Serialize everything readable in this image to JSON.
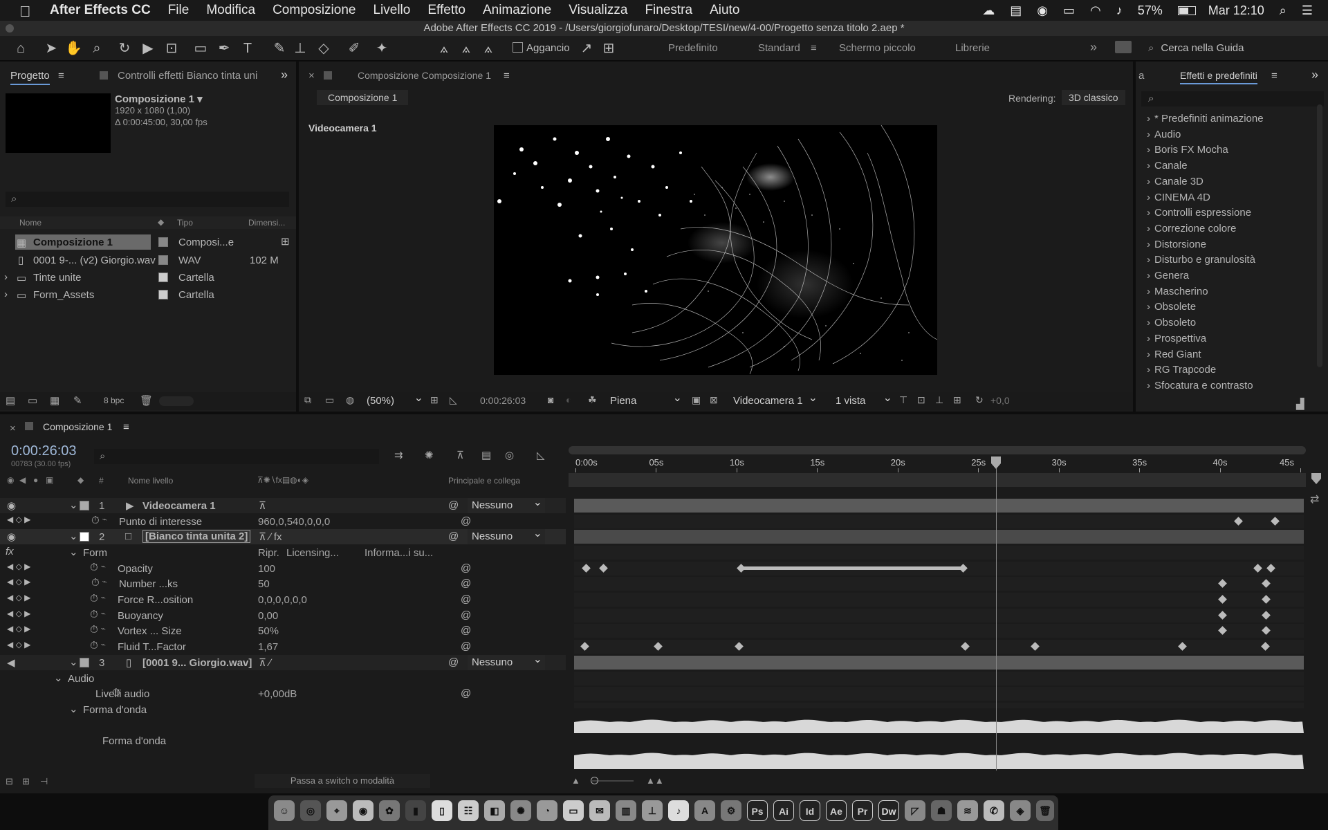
{
  "menubar": {
    "app_name": "After Effects CC",
    "items": [
      "File",
      "Modifica",
      "Composizione",
      "Livello",
      "Effetto",
      "Animazione",
      "Visualizza",
      "Finestra",
      "Aiuto"
    ],
    "battery": "57%",
    "clock": "Mar 12:10"
  },
  "window_title": "Adobe After Effects CC 2019 - /Users/giorgiofunaro/Desktop/TESI/new/4-00/Progetto senza titolo 2.aep *",
  "toolbar": {
    "snap_label": "Aggancio",
    "workspaces": [
      "Predefinito",
      "Standard",
      "Schermo piccolo",
      "Librerie"
    ],
    "search_placeholder": "Cerca nella Guida"
  },
  "project_panel": {
    "tab_label": "Progetto",
    "effect_controls_tab": "Controlli effetti Bianco tinta uni",
    "comp_name": "Composizione 1 ▾",
    "comp_res": "1920 x 1080 (1,00)",
    "comp_duration": "Δ 0:00:45:00, 30,00 fps",
    "col_name": "Nome",
    "col_type": "Tipo",
    "col_size": "Dimensi...",
    "bpc": "8 bpc",
    "items": [
      {
        "name": "Composizione 1",
        "type": "Composi...e",
        "size": ""
      },
      {
        "name": "0001 9-... (v2) Giorgio.wav",
        "type": "WAV",
        "size": "102 M"
      },
      {
        "name": "Tinte unite",
        "type": "Cartella",
        "size": ""
      },
      {
        "name": "Form_Assets",
        "type": "Cartella",
        "size": ""
      }
    ]
  },
  "comp_panel": {
    "tab_label": "Composizione Composizione 1",
    "breadcrumb": "Composizione 1",
    "rendering_label": "Rendering:",
    "renderer": "3D classico",
    "camera_label": "Videocamera 1",
    "zoom": "(50%)",
    "timecode": "0:00:26:03",
    "resolution": "Piena",
    "active_camera": "Videocamera 1",
    "views": "1 vista",
    "exposure": "+0,0"
  },
  "effects_panel": {
    "tab_label": "Effetti e predefiniti",
    "tab_left": "a",
    "items": [
      "* Predefiniti animazione",
      "Audio",
      "Boris FX Mocha",
      "Canale",
      "Canale 3D",
      "CINEMA 4D",
      "Controlli espressione",
      "Correzione colore",
      "Distorsione",
      "Disturbo e granulosità",
      "Genera",
      "Mascherino",
      "Obsolete",
      "Obsoleto",
      "Prospettiva",
      "Red Giant",
      "RG Trapcode",
      "Sfocatura e contrasto"
    ]
  },
  "timeline": {
    "tab_label": "Composizione 1",
    "timecode": "0:00:26:03",
    "frame_info": "00783 (30.00 fps)",
    "col_hash": "#",
    "col_layer_name": "Nome livello",
    "col_parent": "Principale e collega",
    "ruler": [
      "0:00s",
      "05s",
      "10s",
      "15s",
      "20s",
      "25s",
      "30s",
      "35s",
      "40s",
      "45s"
    ],
    "playhead_fraction": 0.58,
    "toggle_label": "Passa a switch o modalità",
    "rows": [
      {
        "num": "1",
        "name": "Videocamera 1",
        "value": "",
        "parent": "Nessuno"
      },
      {
        "num": "",
        "name": "Punto di interesse",
        "value": "960,0,540,0,0,0",
        "parent": ""
      },
      {
        "num": "2",
        "name": "[Bianco tinta unita 2]",
        "value": "",
        "parent": "Nessuno"
      },
      {
        "num": "",
        "name": "Form",
        "value": "Ripr.",
        "extra1": "Licensing...",
        "extra2": "Informa...i su...",
        "parent": ""
      },
      {
        "num": "",
        "name": "Opacity",
        "value": "100",
        "parent": ""
      },
      {
        "num": "",
        "name": "Number ...ks",
        "value": "50",
        "parent": ""
      },
      {
        "num": "",
        "name": "Force R...osition",
        "value": "0,0,0,0,0,0",
        "parent": ""
      },
      {
        "num": "",
        "name": "Buoyancy",
        "value": "0,00",
        "parent": ""
      },
      {
        "num": "",
        "name": "Vortex ... Size",
        "value": "50%",
        "parent": ""
      },
      {
        "num": "",
        "name": "Fluid T...Factor",
        "value": "1,67",
        "parent": ""
      },
      {
        "num": "3",
        "name": "[0001 9... Giorgio.wav]",
        "value": "",
        "parent": "Nessuno"
      },
      {
        "num": "",
        "name": "Audio",
        "value": "",
        "parent": ""
      },
      {
        "num": "",
        "name": "Livelli audio",
        "value": "+0,00dB",
        "parent": ""
      },
      {
        "num": "",
        "name": "Forma d'onda",
        "value": "",
        "parent": ""
      },
      {
        "num": "",
        "name": "Forma d'onda",
        "value": "",
        "parent": ""
      }
    ]
  },
  "dock": {
    "apps": [
      "Ps",
      "Ai",
      "Id",
      "Ae",
      "Pr",
      "Dw"
    ]
  }
}
